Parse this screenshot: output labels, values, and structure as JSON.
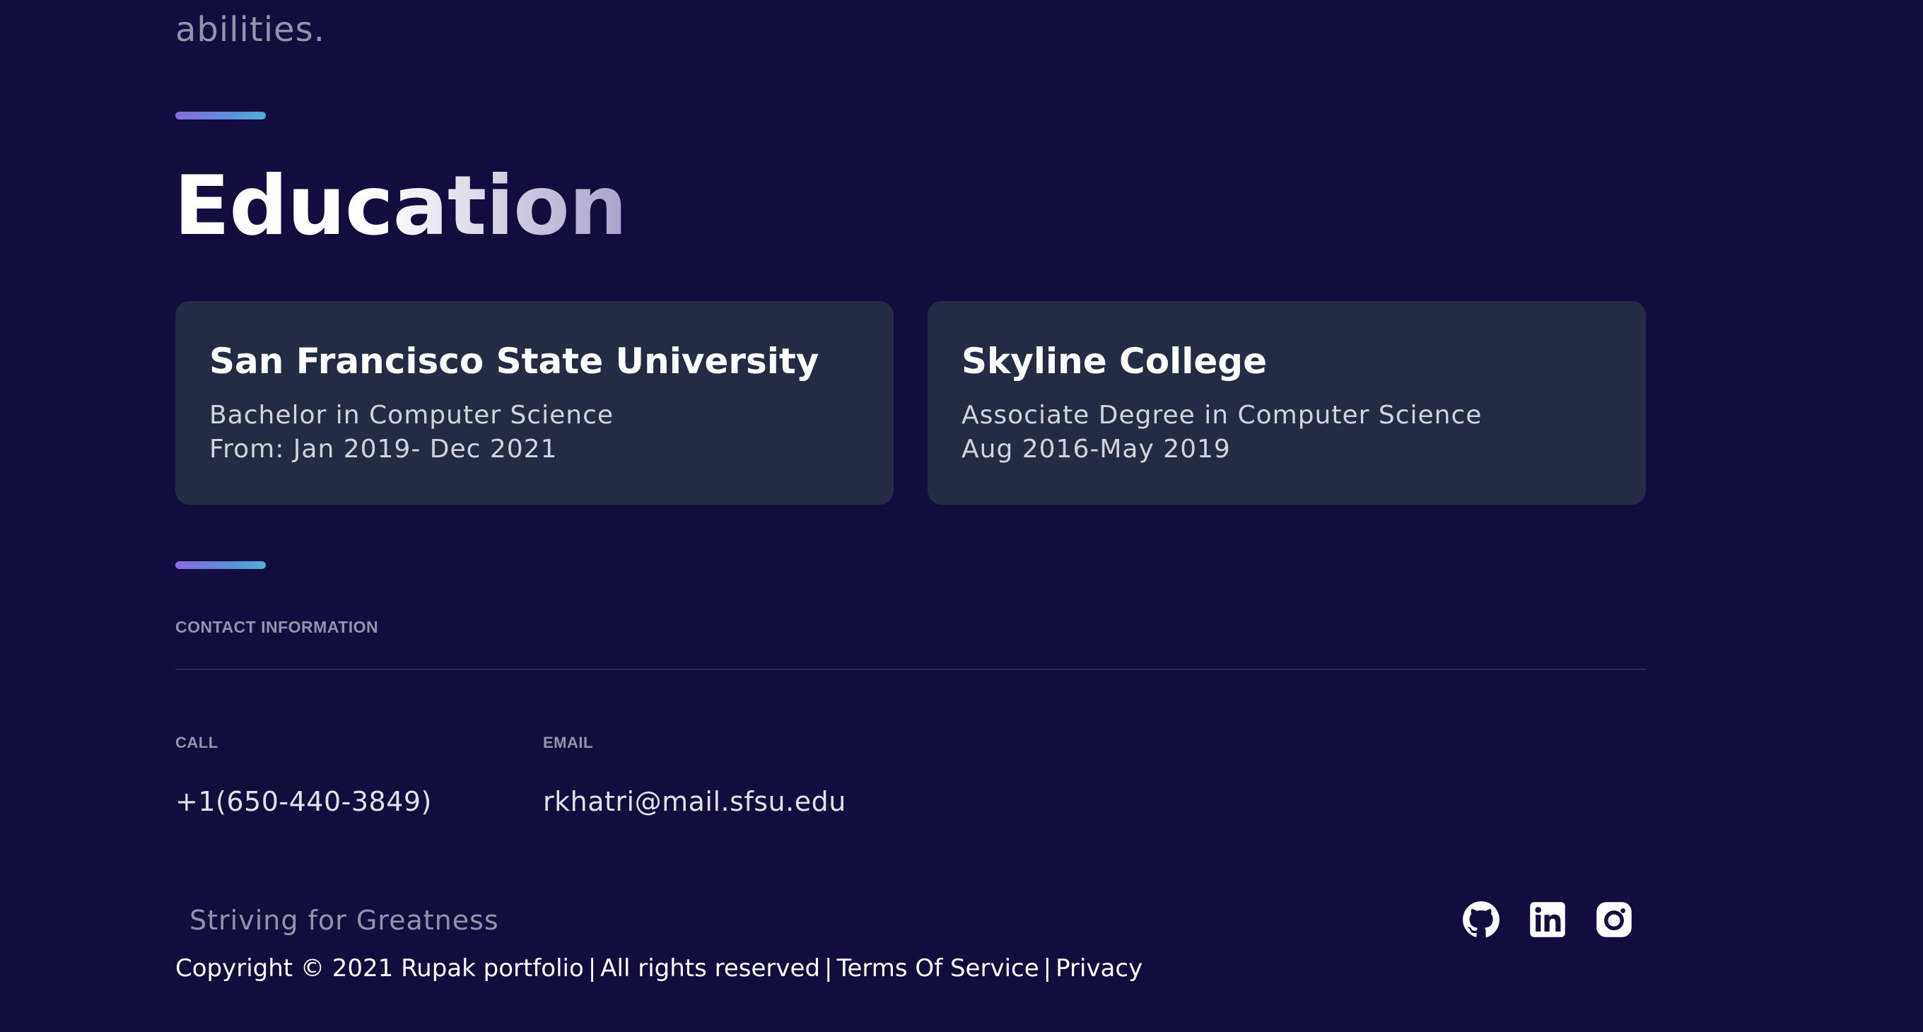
{
  "intro": {
    "tail_text": "abilities."
  },
  "education": {
    "title": "Education",
    "cards": [
      {
        "school": "San Francisco State University",
        "degree": "Bachelor in Computer Science",
        "dates": "From: Jan 2019- Dec 2021"
      },
      {
        "school": "Skyline College",
        "degree": "Associate Degree in Computer Science",
        "dates": "Aug 2016-May 2019"
      }
    ]
  },
  "contact": {
    "heading": "CONTACT INFORMATION",
    "call_label": "CALL",
    "call_value": "+1(650-440-3849)",
    "email_label": "EMAIL",
    "email_value": "rkhatri@mail.sfsu.edu"
  },
  "footer": {
    "tagline": "Striving for Greatness",
    "copyright": "Copyright © 2021 Rupak portfolio",
    "rights": "All rights reserved",
    "terms": "Terms Of Service",
    "privacy": "Privacy",
    "separator": "|",
    "social_icons": [
      "github-icon",
      "linkedin-icon",
      "instagram-icon"
    ]
  },
  "colors": {
    "background": "#120c3f",
    "card": "#232c43",
    "accent_gradient_start": "#8a6be0",
    "accent_gradient_end": "#4fb0d8"
  }
}
